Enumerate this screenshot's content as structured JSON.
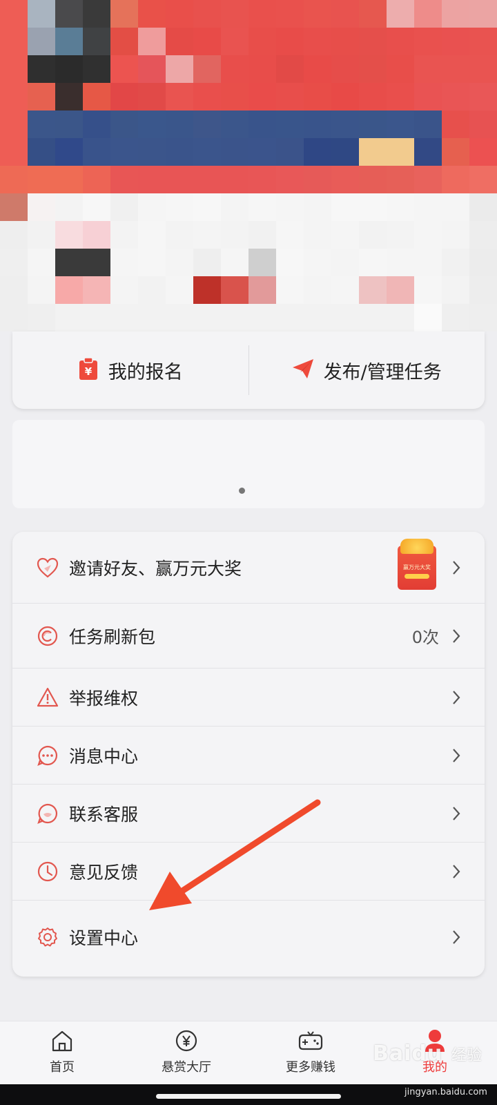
{
  "profile_header": {
    "mosaic_colors": [
      [
        "#ee5d55",
        "#a9b4c0",
        "#4a4a4c",
        "#3a3a3a",
        "#e5725a",
        "#e95149",
        "#e94f4a",
        "#e8514d",
        "#e8534f",
        "#e9504c",
        "#e9514d",
        "#e9544e",
        "#e8534f",
        "#e6584f",
        "#edadad",
        "#ee8c8a",
        "#eca3a2",
        "#eba4a3"
      ],
      [
        "#ee5d55",
        "#9aa2b0",
        "#5a7d96",
        "#404244",
        "#e34e45",
        "#ef9c9c",
        "#e54b47",
        "#e84b48",
        "#e95350",
        "#e84e4a",
        "#e84c49",
        "#e84e4b",
        "#e74e4a",
        "#e54f4b",
        "#e84f4c",
        "#e9514e",
        "#e95150",
        "#e95350"
      ],
      [
        "#ee5d55",
        "#2f2f2f",
        "#2b2b2b",
        "#303030",
        "#ec5450",
        "#e5555a",
        "#eda7a7",
        "#e16560",
        "#e84e4b",
        "#e84d4a",
        "#e24a47",
        "#e84b48",
        "#e64d4a",
        "#e44f4a",
        "#e84e4a",
        "#e95451",
        "#e95451",
        "#e95451"
      ],
      [
        "#ee5d55",
        "#e66150",
        "#3a2e2d",
        "#e65846",
        "#e24747",
        "#e14a48",
        "#e95450",
        "#e94f4c",
        "#e84f4a",
        "#e94c4a",
        "#e84e4b",
        "#e84d48",
        "#e84a47",
        "#e84d4a",
        "#e94f4c",
        "#e95353",
        "#e95555",
        "#e95757"
      ],
      [
        "#ee5d55",
        "#3b568a",
        "#3b5689",
        "#36508a",
        "#3b5689",
        "#3a578c",
        "#3a568b",
        "#3e568a",
        "#3b568b",
        "#39548b",
        "#39558b",
        "#39548b",
        "#3a558b",
        "#3a568a",
        "#3b568c",
        "#3a548a",
        "#e7504c",
        "#e75252"
      ],
      [
        "#ee5d55",
        "#354f86",
        "#30498a",
        "#39538b",
        "#3b558c",
        "#3b558b",
        "#3a548b",
        "#3b558c",
        "#3b548b",
        "#3b548c",
        "#3b538a",
        "#2f4785",
        "#2f4884",
        "#f2cb8e",
        "#f2cb8e",
        "#324985",
        "#e6604f",
        "#ec5151"
      ],
      [
        "#ee6a55",
        "#ef6c54",
        "#ef6c54",
        "#ed6455",
        "#e85655",
        "#e85555",
        "#e85555",
        "#e85555",
        "#e85555",
        "#e85656",
        "#e85858",
        "#e65a58",
        "#e85c58",
        "#e65e57",
        "#e66058",
        "#e8625c",
        "#ee6a5e",
        "#ef6e63"
      ],
      [
        "#cf7a6a",
        "#f6f2f2",
        "#f3f3f3",
        "#f7f7f7",
        "#f0f0f0",
        "#f5f5f5",
        "#f6f6f6",
        "#f7f7f7",
        "#f4f4f4",
        "#f6f6f6",
        "#f5f5f5",
        "#f4f4f4",
        "#f7f7f7",
        "#f7f7f7",
        "#f6f6f6",
        "#f5f5f5",
        "#f5f5f5",
        "#ebebeb"
      ],
      [
        "#eeeeee",
        "#f2f2f2",
        "#f8dcdf",
        "#f7d0d5",
        "#f3f3f3",
        "#f6f6f6",
        "#f3f3f3",
        "#f4f4f4",
        "#f3f3f3",
        "#f1f1f1",
        "#f6f6f6",
        "#f4f4f4",
        "#f5f5f5",
        "#f2f2f2",
        "#f3f3f3",
        "#f5f5f5",
        "#f4f4f4",
        "#ededed"
      ],
      [
        "#efefef",
        "#f5f5f5",
        "#3a3a3a",
        "#3a3a3a",
        "#f5f5f5",
        "#f6f6f6",
        "#f4f4f4",
        "#eeeeee",
        "#f5f5f5",
        "#cfcfcf",
        "#f7f7f7",
        "#f5f5f5",
        "#f4f4f4",
        "#f6f6f6",
        "#f5f5f5",
        "#f5f5f5",
        "#f1f1f1",
        "#ececec"
      ],
      [
        "#eeeeee",
        "#f4f4f4",
        "#f7a9a8",
        "#f5b5b5",
        "#f4f4f4",
        "#f2f2f2",
        "#f5f5f5",
        "#be3129",
        "#d9534c",
        "#e29a9a",
        "#f6f6f6",
        "#f4f4f4",
        "#f5f5f5",
        "#eec2c2",
        "#f0b6b6",
        "#f6f6f6",
        "#f3f3f3",
        "#ededed"
      ],
      [
        "#eeeeee",
        "#efefef",
        "#f2f2f2",
        "#f2f2f2",
        "#f2f2f2",
        "#f2f2f2",
        "#f2f2f2",
        "#f2f2f2",
        "#f2f2f2",
        "#f2f2f2",
        "#f2f2f2",
        "#f2f2f2",
        "#f2f2f2",
        "#f2f2f2",
        "#f2f2f2",
        "#fafafa",
        "#efefef",
        "#eeeeee"
      ]
    ]
  },
  "quick_actions": [
    {
      "label": "我的报名",
      "icon": "clipboard-yen-icon"
    },
    {
      "label": "发布/管理任务",
      "icon": "paper-plane-icon"
    }
  ],
  "menu": {
    "items": [
      {
        "label": "邀请好友、赢万元大奖",
        "icon": "heart-icon",
        "promo_text": "赢万元大奖"
      },
      {
        "label": "任务刷新包",
        "icon": "refresh-circle-icon",
        "value": "0次"
      },
      {
        "label": "举报维权",
        "icon": "warning-icon"
      },
      {
        "label": "消息中心",
        "icon": "chat-bubble-icon"
      },
      {
        "label": "联系客服",
        "icon": "customer-service-icon"
      },
      {
        "label": "意见反馈",
        "icon": "clock-icon"
      },
      {
        "label": "设置中心",
        "icon": "gear-icon"
      }
    ]
  },
  "tabbar": {
    "tabs": [
      {
        "label": "首页",
        "icon": "home-icon"
      },
      {
        "label": "悬赏大厅",
        "icon": "yen-circle-icon"
      },
      {
        "label": "更多赚钱",
        "icon": "gamepad-icon"
      },
      {
        "label": "我的",
        "icon": "user-icon"
      }
    ]
  },
  "watermark": {
    "brand": "Bai",
    "brand_suffix": "du",
    "sub": "经验",
    "url": "jingyan.baidu.com"
  },
  "colors": {
    "accent": "#ee3b3b",
    "arrow": "#f04a2c"
  }
}
